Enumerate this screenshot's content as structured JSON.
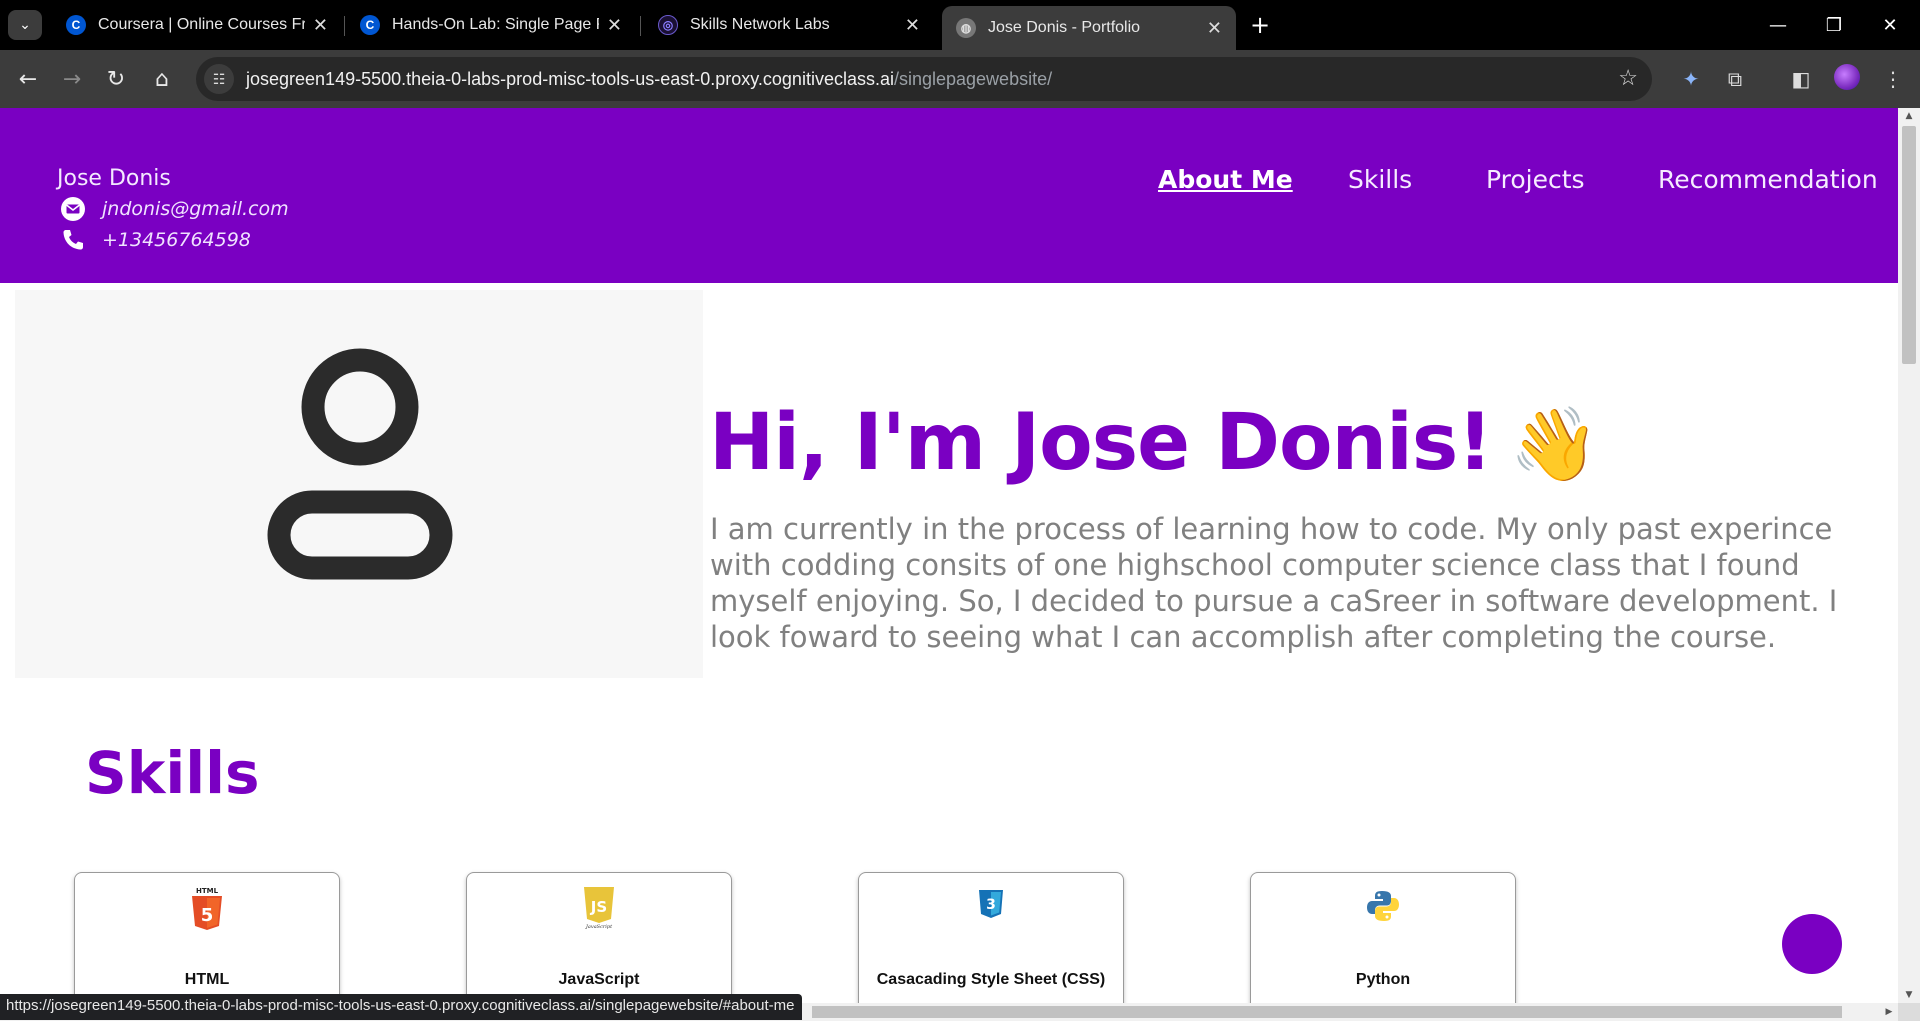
{
  "browser": {
    "tabs": [
      {
        "title": "Coursera | Online Courses From",
        "active": false
      },
      {
        "title": "Hands-On Lab: Single Page Por",
        "active": false
      },
      {
        "title": "Skills Network Labs",
        "active": false
      },
      {
        "title": "Jose Donis - Portfolio",
        "active": true
      }
    ],
    "url_host": "josegreen149-5500.theia-0-labs-prod-misc-tools-us-east-0.proxy.cognitiveclass.ai",
    "url_path": "/singlepagewebsite/",
    "status_url": "https://josegreen149-5500.theia-0-labs-prod-misc-tools-us-east-0.proxy.cognitiveclass.ai/singlepagewebsite/#about-me",
    "accent_color": "#7a00c2"
  },
  "header": {
    "name": "Jose Donis",
    "email": "jndonis@gmail.com",
    "phone": "+13456764598",
    "nav": [
      {
        "label": "About Me",
        "current": true
      },
      {
        "label": "Skills",
        "current": false
      },
      {
        "label": "Projects",
        "current": false
      },
      {
        "label": "Recommendation",
        "current": false
      }
    ]
  },
  "about": {
    "greeting": "Hi, I'm Jose Donis!",
    "wave": "👋",
    "bio": "I am currently in the process of learning how to code. My only past experince with codding consits of one highschool computer science class that I found myself enjoying. So, I decided to pursue a caSreer in software development. I look foward to seeing what I can accomplish after completing the course.",
    "avatar_icon": "user-icon"
  },
  "skills": {
    "title": "Skills",
    "items": [
      {
        "name": "HTML",
        "icon": "html5-icon"
      },
      {
        "name": "JavaScript",
        "icon": "javascript-icon"
      },
      {
        "name": "Casacading Style Sheet (CSS)",
        "icon": "css3-icon"
      },
      {
        "name": "Python",
        "icon": "python-icon"
      }
    ]
  }
}
